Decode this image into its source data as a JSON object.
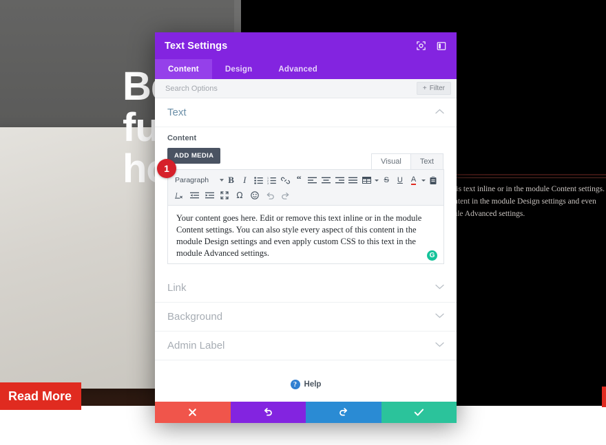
{
  "background": {
    "hero_headline": "Beautifully made\nfurniture for your\nhome.",
    "hero_paragraph": "Your content goes here. Edit or remove this text inline or in the module Content settings. You can also style every aspect of this content in the module Design settings and even apply custom CSS to this text in the module Advanced settings.",
    "cta_label": "Read More",
    "colors": {
      "cta_red": "#e02b20",
      "hero_dark": "#000000",
      "headline_white": "#ffffff"
    }
  },
  "modal": {
    "title": "Text Settings",
    "header_icons": [
      {
        "name": "expand-icon",
        "label": "Expand"
      },
      {
        "name": "layout-toggle-icon",
        "label": "Toggle Layout"
      }
    ],
    "tabs": [
      {
        "label": "Content",
        "active": true
      },
      {
        "label": "Design",
        "active": false
      },
      {
        "label": "Advanced",
        "active": false
      }
    ],
    "search": {
      "placeholder": "Search Options",
      "value": "",
      "filter_label": "Filter"
    },
    "sections": [
      {
        "label": "Text",
        "open": true
      },
      {
        "label": "Link",
        "open": false
      },
      {
        "label": "Background",
        "open": false
      },
      {
        "label": "Admin Label",
        "open": false
      }
    ],
    "content_section": {
      "field_label": "Content",
      "add_media_label": "ADD MEDIA",
      "editor_modes": [
        {
          "label": "Visual",
          "active": true
        },
        {
          "label": "Text",
          "active": false
        }
      ],
      "toolbar": {
        "format_select": "Paragraph",
        "row1": [
          "bold-icon",
          "italic-icon",
          "bulleted-list-icon",
          "numbered-list-icon",
          "link-icon",
          "blockquote-icon",
          "align-left-icon",
          "align-center-icon",
          "align-right-icon",
          "align-justify-icon",
          "table-icon",
          "strikethrough-icon",
          "underline-icon",
          "text-color-icon",
          "paste-icon"
        ],
        "row2": [
          "clear-formatting-icon",
          "outdent-icon",
          "indent-icon",
          "fullscreen-icon",
          "special-character-icon",
          "emoji-icon",
          "undo-icon",
          "redo-icon"
        ]
      },
      "editor_value": "Your content goes here. Edit or remove this text inline or in the module Content settings. You can also style every aspect of this content in the module Design settings and even apply custom CSS to this text in the module Advanced settings.",
      "grammarly_badge": "G"
    },
    "help": {
      "label": "Help"
    },
    "footer_buttons": [
      {
        "name": "cancel-button",
        "icon": "close-icon",
        "color": "#f0554b"
      },
      {
        "name": "undo-button",
        "icon": "undo-icon",
        "color": "#8324e0"
      },
      {
        "name": "redo-button",
        "icon": "redo-icon",
        "color": "#2a8bd4"
      },
      {
        "name": "save-button",
        "icon": "check-icon",
        "color": "#2bc39b"
      }
    ],
    "colors": {
      "header_purple": "#8324e0",
      "tab_active": "#9540ea",
      "section_label": "#6b8fa8"
    }
  },
  "annotation": {
    "step_number": "1"
  }
}
